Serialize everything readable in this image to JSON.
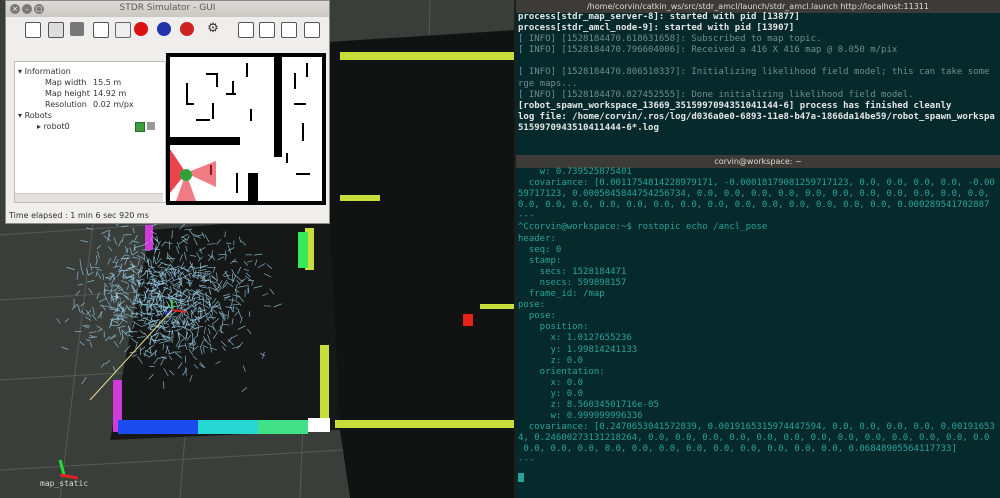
{
  "stdr": {
    "title": "STDR Simulator - GUI",
    "window_buttons": [
      "×",
      "–",
      "□"
    ],
    "tree": {
      "information_label": "Information",
      "map_width_label": "Map width",
      "map_width_value": "15.5 m",
      "map_height_label": "Map height",
      "map_height_value": "14.92 m",
      "resolution_label": "Resolution",
      "resolution_value": "0.02 m/px",
      "robots_label": "Robots",
      "robot_name": "robot0"
    },
    "status": "Time elapsed : 1 min 6 sec 920 ms"
  },
  "rviz": {
    "frame_label": "map_static"
  },
  "term1": {
    "title": "/home/corvin/catkin_ws/src/stdr_amcl/launch/stdr_amcl.launch http://localhost:11311",
    "lines": [
      {
        "text": "process[stdr_map_server-8]: started with pid [13877]",
        "style": "white"
      },
      {
        "text": "process[stdr_amcl_node-9]: started with pid [13907]",
        "style": "white"
      },
      {
        "text": "[ INFO] [1528184470.618631658]: Subscribed to map topic.",
        "style": "grey"
      },
      {
        "text": "[ INFO] [1528184470.796604006]: Received a 416 X 416 map @ 0.050 m/pix",
        "style": "grey"
      },
      {
        "text": "",
        "style": "grey"
      },
      {
        "text": "[ INFO] [1528184470.806510337]: Initializing likelihood field model; this can take some",
        "style": "grey"
      },
      {
        "text": "rge maps...",
        "style": "grey"
      },
      {
        "text": "[ INFO] [1528184470.827452555]: Done initializing likelihood field model.",
        "style": "grey"
      },
      {
        "text": "[robot_spawn_workspace_13669_3515997094351041144-6] process has finished cleanly",
        "style": "white"
      },
      {
        "text": "log file: /home/corvin/.ros/log/d036a0e0-6893-11e8-b47a-1866da14be59/robot_spawn_workspa",
        "style": "white"
      },
      {
        "text": "5159970943510411444-6*.log",
        "style": "white"
      }
    ]
  },
  "term2": {
    "title": "corvin@workspace: ~",
    "lines": [
      "    w: 0.739525875401",
      "  covariance: [0.0011754814228979171, -0.00018179081259717123, 0.0, 0.0, 0.0, 0.0, -0.00",
      "59717123, 0.0005045844754256734, 0.0, 0.0, 0.0, 0.0, 0.0, 0.0, 0.0, 0.0, 0.0, 0.0, 0.0,",
      "0.0, 0.0, 0.0, 0.0, 0.0, 0.0, 0.0, 0.0, 0.0, 0.0, 0.0, 0.0, 0.0, 0.0, 0.000289541702887",
      "---",
      "^Ccorvin@workspace:~$ rostopic echo /ancl_pose",
      "header:",
      "  seq: 0",
      "  stamp:",
      "    secs: 1528184471",
      "    nsecs: 599898157",
      "  frame_id: /map",
      "pose:",
      "  pose:",
      "    position:",
      "      x: 1.0127655236",
      "      y: 1.99814241133",
      "      z: 0.0",
      "    orientation:",
      "      x: 0.0",
      "      y: 0.0",
      "      z: 8.56034501716e-05",
      "      w: 0.999999996336",
      "  covariance: [0.2470653041572839, 0.0019165315974447594, 0.0, 0.0, 0.0, 0.0, 0.00191653",
      "4, 0.24600273131218264, 0.0, 0.0, 0.0, 0.0, 0.0, 0.0, 0.0, 0.0, 0.0, 0.0, 0.0, 0.0, 0.0",
      " 0.0, 0.0, 0.0, 0.0, 0.0, 0.0, 0.0, 0.0, 0.0, 0.0, 0.0, 0.0, 0.06848905564117733]",
      "---"
    ]
  },
  "colors": {
    "terminal_bg": "#062a2c",
    "rviz_bg": "#3a3e3b",
    "particles": "#9fd4ee",
    "wall_yellow": "#c7dd3a"
  }
}
